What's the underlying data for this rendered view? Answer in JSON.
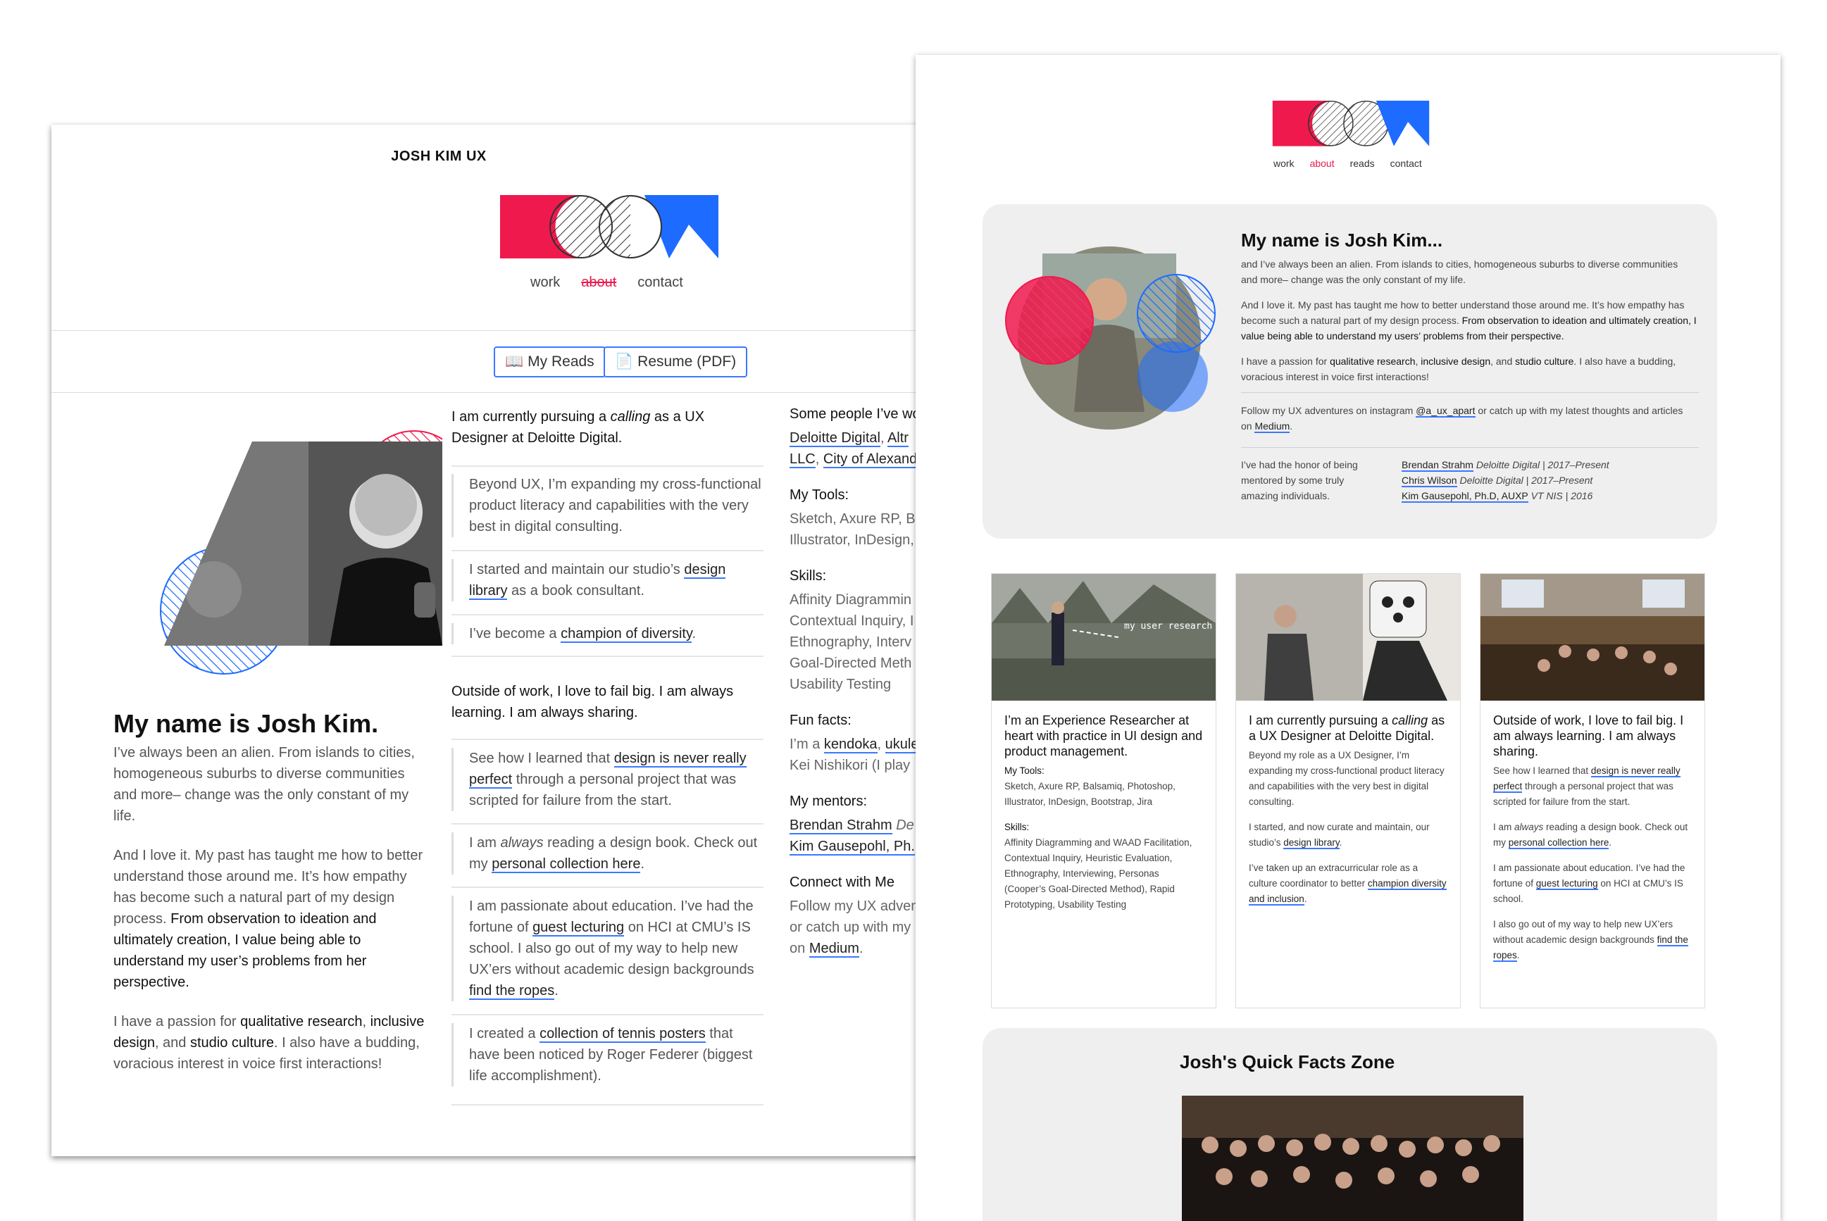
{
  "left": {
    "brand": "JOSH KIM UX",
    "nav": [
      "work",
      "about",
      "contact"
    ],
    "buttons": {
      "reads": "My Reads",
      "resume": "Resume (PDF)"
    },
    "intro_title": "My name is Josh Kim.",
    "intro_p1": "I’ve always been an alien. From islands to cities, homogeneous suburbs to diverse communities and more– change was the only constant of my life.",
    "intro_p2a": "And I love it. My past has taught me how to better understand those around me. It’s how empathy has become such a natural part of my design process. ",
    "intro_p2b": "From observation to ideation and ultimately creation, I value being able to understand my user’s problems from her perspective.",
    "intro_p3a": "I have a passion for ",
    "intro_p3b": "qualitative research",
    "intro_p3c": ", ",
    "intro_p3d": "inclusive design",
    "intro_p3e": ", and ",
    "intro_p3f": "studio culture",
    "intro_p3g": ". I also have a budding, voracious interest in voice first interactions!",
    "col2_lead1a": "I am currently pursuing a ",
    "col2_lead1b": "calling",
    "col2_lead1c": " as a UX Designer at Deloitte Digital.",
    "col2_i1": "Beyond UX, I’m expanding my cross-functional product literacy and capabilities with the very best in digital consulting.",
    "col2_i2a": "I started and maintain our studio’s ",
    "col2_i2b": "design library",
    "col2_i2c": " as a book consultant.",
    "col2_i3a": "I’ve become a ",
    "col2_i3b": "champion of diversity",
    "col2_i3c": ".",
    "col2_lead2": "Outside of work, I love to fail big. I am always learning. I am always sharing.",
    "col2_i4a": "See how I learned that ",
    "col2_i4b": "design is never really perfect",
    "col2_i4c": " through a personal project that was scripted for failure from the start.",
    "col2_i5a": "I am ",
    "col2_i5b": "always",
    "col2_i5c": " reading a design book. Check out my ",
    "col2_i5d": "personal collection here",
    "col2_i5e": ".",
    "col2_i6a": "I am passionate about education. I’ve had the fortune of ",
    "col2_i6b": "guest lecturing",
    "col2_i6c": " on HCI at CMU’s IS school. I also go out of my way to help new UX’ers without academic design backgrounds ",
    "col2_i6d": "find the ropes",
    "col2_i6e": ".",
    "col2_i7a": "I created a ",
    "col2_i7b": "collection of tennis posters",
    "col2_i7c": " that have been noticed by Roger Federer (biggest life accomplishment).",
    "col3": {
      "people_h": "Some people I’ve wo",
      "people_l1a": "Deloitte Digital",
      "people_l1b": ", ",
      "people_l1c": "Altr",
      "people_l2a": "LLC",
      "people_l2b": ", ",
      "people_l2c": "City of Alexand",
      "tools_h": "My Tools:",
      "tools": [
        "Sketch, Axure RP, B",
        "Illustrator, InDesign,"
      ],
      "skills_h": "Skills:",
      "skills": [
        "Affinity Diagrammin",
        "Contextual Inquiry, I",
        "Ethnography, Interv",
        "Goal-Directed Meth",
        "Usability Testing"
      ],
      "fun_h": "Fun facts:",
      "fun_l1a": "I’m a ",
      "fun_l1b": "kendoka",
      "fun_l1c": ", ",
      "fun_l1d": "ukule",
      "fun_l2": "Kei Nishikori (I play",
      "mentors_h": "My mentors:",
      "mentor1a": "Brendan Strahm",
      "mentor1b": " De",
      "mentor2": "Kim Gausepohl, Ph.",
      "connect_h": "Connect with Me",
      "connect_l1": "Follow my UX adven",
      "connect_l2": "or catch up with my",
      "connect_l3a": "on ",
      "connect_l3b": "Medium",
      "connect_l3c": "."
    }
  },
  "right": {
    "nav": [
      "work",
      "about",
      "reads",
      "contact"
    ],
    "hero_title": "My name is Josh Kim...",
    "hero_p1": "and I’ve always been an alien. From islands to cities, homogeneous suburbs to diverse communities and more– change was the only constant of my life.",
    "hero_p2a": "And I love it. My past has taught me how to better understand those around me. It’s how empathy has become such a natural part of my design process. ",
    "hero_p2b": "From observation to ideation and ultimately creation, I value being able to understand my users’ problems from their perspective.",
    "hero_p3a": "I have a passion for ",
    "hero_p3b": "qualitative research",
    "hero_p3c": ", ",
    "hero_p3d": "inclusive design",
    "hero_p3e": ", and ",
    "hero_p3f": "studio culture",
    "hero_p3g": ". I also have a budding, voracious interest in voice first interactions!",
    "hero_follow_a": "Follow my UX adventures on instagram ",
    "hero_follow_b": "@a_ux_apart",
    "hero_follow_c": " or catch up with my latest thoughts and articles on ",
    "hero_follow_d": "Medium",
    "hero_follow_e": ".",
    "mentored": "I’ve had the honor of being mentored by some truly amazing individuals.",
    "mentors": [
      {
        "name": "Brendan Strahm",
        "org": " Deloitte Digital | 2017–Present"
      },
      {
        "name": "Chris Wilson",
        "org": " Deloitte Digital | 2017–Present"
      },
      {
        "name": "Kim Gausepohl, Ph.D, AUXP",
        "org": " VT NIS | 2016"
      }
    ],
    "tile1": {
      "caption": "my user research guide",
      "title": "I’m an Experience Researcher at heart with practice in UI design and product management.",
      "tools_h": "My Tools:",
      "tools": "Sketch, Axure RP, Balsamiq, Photoshop, Illustrator, InDesign, Bootstrap, Jira",
      "skills_h": "Skills:",
      "skills": "Affinity Diagramming and WAAD Facilitation, Contextual Inquiry, Heuristic Evaluation, Ethnography, Interviewing, Personas (Cooper’s Goal-Directed Method), Rapid Prototyping, Usability Testing"
    },
    "tile2": {
      "title_a": "I am currently pursuing a ",
      "title_b": "calling",
      "title_c": " as a UX Designer at Deloitte Digital.",
      "p1": "Beyond my role as a UX Designer, I’m expanding my cross-functional product literacy and capabilities with the very best in digital consulting.",
      "p2a": "I started, and now curate and maintain, our studio’s ",
      "p2b": "design library",
      "p2c": ".",
      "p3a": "I’ve taken up an extracurricular role as a culture coordinator to better ",
      "p3b": "champion diversity and inclusion",
      "p3c": "."
    },
    "tile3": {
      "title": "Outside of work, I love to fail big. I am always learning. I am always sharing.",
      "p1a": "See how I learned that ",
      "p1b": "design is never really perfect",
      "p1c": " through a personal project that was scripted for failure from the start.",
      "p2a": "I am ",
      "p2b": "always",
      "p2c": " reading a design book. Check out my ",
      "p2d": "personal collection here",
      "p2e": ".",
      "p3a": "I am passionate about education. I’ve had the fortune of ",
      "p3b": "guest lecturing",
      "p3c": " on HCI at CMU’s IS school.",
      "p4a": "I also go out of my way to help new UX’ers without academic design backgrounds ",
      "p4b": "find the ropes",
      "p4c": "."
    },
    "facts_title": "Josh's Quick Facts Zone"
  },
  "colors": {
    "accent_red": "#f0194d",
    "accent_blue": "#1e6bff",
    "link_underline": "#3a78ff",
    "card_bg": "#efefef"
  }
}
